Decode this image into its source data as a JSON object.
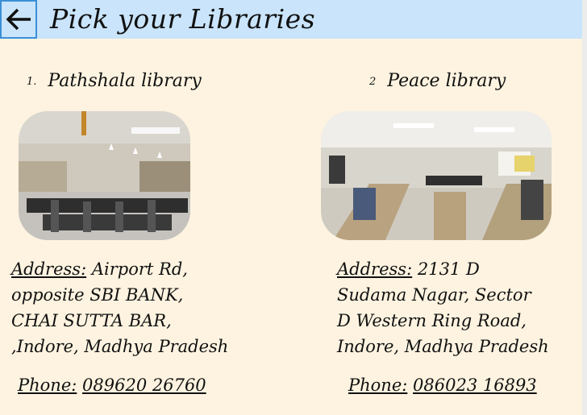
{
  "header": {
    "title": "Pick your Libraries",
    "back_icon": "arrow-left-icon"
  },
  "libraries": [
    {
      "number": "1.",
      "name": "Pathshala library",
      "address_label": "Address:",
      "address_lines": [
        "Airport Rd,",
        "opposite SBI BANK,",
        "CHAI SUTTA BAR,",
        ",Indore, Madhya Pradesh"
      ],
      "phone_label": "Phone:",
      "phone": "089620 26760"
    },
    {
      "number": "2",
      "name": "Peace library",
      "address_label": "Address:",
      "address_lines": [
        "2131 D",
        "Sudama Nagar, Sector",
        "D Western Ring Road,",
        "Indore, Madhya Pradesh"
      ],
      "phone_label": "Phone:",
      "phone": "086023 16893"
    }
  ]
}
